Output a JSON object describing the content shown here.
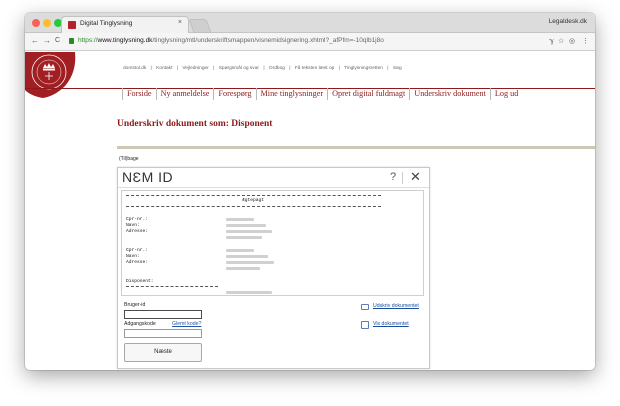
{
  "browser": {
    "tab_title": "Digital Tinglysning",
    "tab_close": "×",
    "profile": "Legaldesk.dk",
    "url_scheme": "https://",
    "url_host": "www.tinglysning.dk",
    "url_path": "/tinglysning/mtl/underskriftsmappen/visnemidsignering.xhtml?_afPfm=-10qlb1j8o",
    "nav_back": "←",
    "nav_forward": "→",
    "nav_reload": "C",
    "toolbar_icons": [
      "ℽ",
      "☆",
      "◎",
      "⋮"
    ]
  },
  "site": {
    "utility_links": [
      "domstol.dk",
      "|",
      "Kontakt",
      "|",
      "Vejledninger",
      "|",
      "Spørgsmål og svar",
      "|",
      "Ordbog",
      "|",
      "Få teksten læst op",
      "|",
      "Tinglysningsretten",
      "|",
      "Søg"
    ],
    "nav_items": [
      "Forside",
      "Ny anmeldelse",
      "Forespørg",
      "Mine tinglysninger",
      "Opret digital fuldmagt",
      "Underskriv dokument",
      "Log ud"
    ],
    "heading": "Underskriv dokument som: Disponent",
    "back_link": "(Til)bage"
  },
  "nemid": {
    "logo": "NƐM ID",
    "help": "?",
    "close": "✕",
    "doc_title": "Ægtepagt",
    "doc_labels": [
      "Cpr-nr.:",
      "Navn:",
      "Adresse:",
      "Cpr-nr.:",
      "Navn:",
      "Adresse:",
      "Disponent:"
    ],
    "user_id_label": "Bruger-id",
    "user_id_value": "",
    "password_label": "Adgangskode",
    "password_value": "",
    "forgot_label": "Glemt kode?",
    "next_button": "Næste",
    "print_link": "Udskriv dokumentet",
    "view_link": "Vis dokumentet"
  },
  "colors": {
    "brand_red": "#8b1a1a",
    "link_blue": "#1a4fa0",
    "secure_green": "#2a8a2a"
  }
}
